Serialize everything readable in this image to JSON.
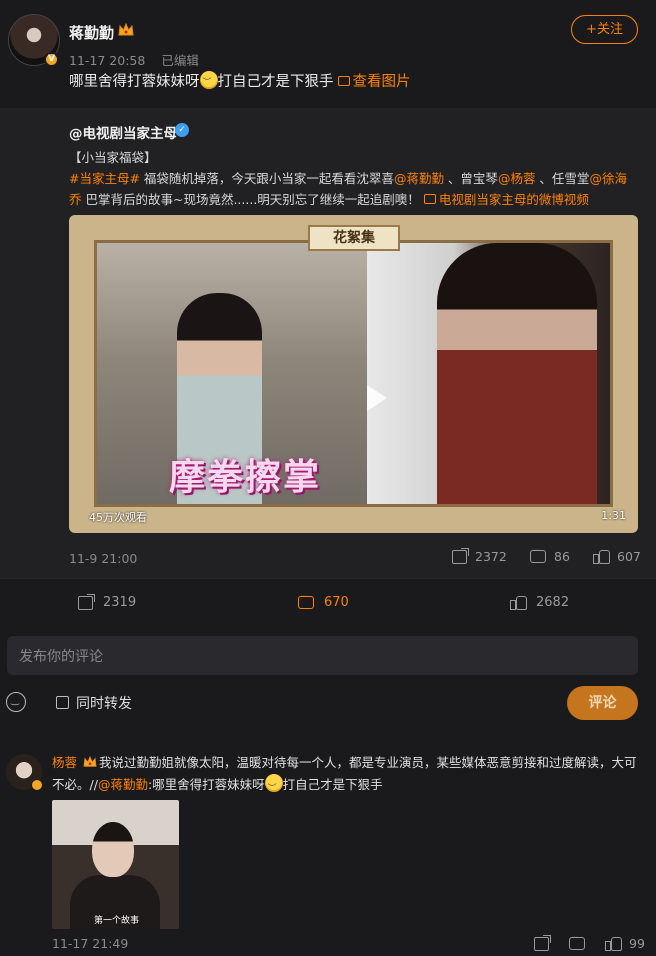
{
  "post": {
    "username": "蒋勤勤",
    "timestamp": "11-17 20:58",
    "edited": "已编辑",
    "follow_label": "+关注",
    "text_before": "哪里舍得打蓉妹妹呀",
    "text_after": "打自己才是下狠手",
    "view_image": "查看图片"
  },
  "repost": {
    "author": "@电视剧当家主母",
    "line1": "【小当家福袋】",
    "tag1": "#当家主母#",
    "body1": " 福袋随机掉落，今天跟小当家一起看看沈翠喜",
    "mention1": "@蒋勤勤",
    "body2": " 、曾宝琴",
    "mention2": "@杨蓉",
    "body3": " 、任雪堂",
    "mention3": "@徐海乔",
    "body4": " 巴掌背后的故事~现场竟然......明天别忘了继续一起追剧噢！",
    "video_link": "电视剧当家主母的微博视频",
    "video": {
      "banner": "花絮集",
      "caption": "摩拳擦掌",
      "views": "45万次观看",
      "duration": "1:31"
    },
    "date": "11-9 21:00",
    "shares": "2372",
    "comments": "86",
    "likes": "607"
  },
  "actions": {
    "shares": "2319",
    "comments": "670",
    "likes": "2682"
  },
  "composer": {
    "placeholder": "发布你的评论",
    "repost_label": "同时转发",
    "submit_label": "评论"
  },
  "comment": {
    "user": "杨蓉",
    "text1": "我说过勤勤姐就像太阳，温暖对待每一个人，都是专业演员，某些媒体恶意剪接和过度解读，大可不必。//",
    "mention": "@蒋勤勤",
    "text2": ":哪里舍得打蓉妹妹呀",
    "text3": "打自己才是下狠手",
    "thumb_caption": "第一个故事",
    "date": "11-17 21:49",
    "likes": "99"
  },
  "colors": {
    "accent": "#ff8200",
    "background": "#1a1a1d",
    "verified": "#3d9ef0"
  }
}
